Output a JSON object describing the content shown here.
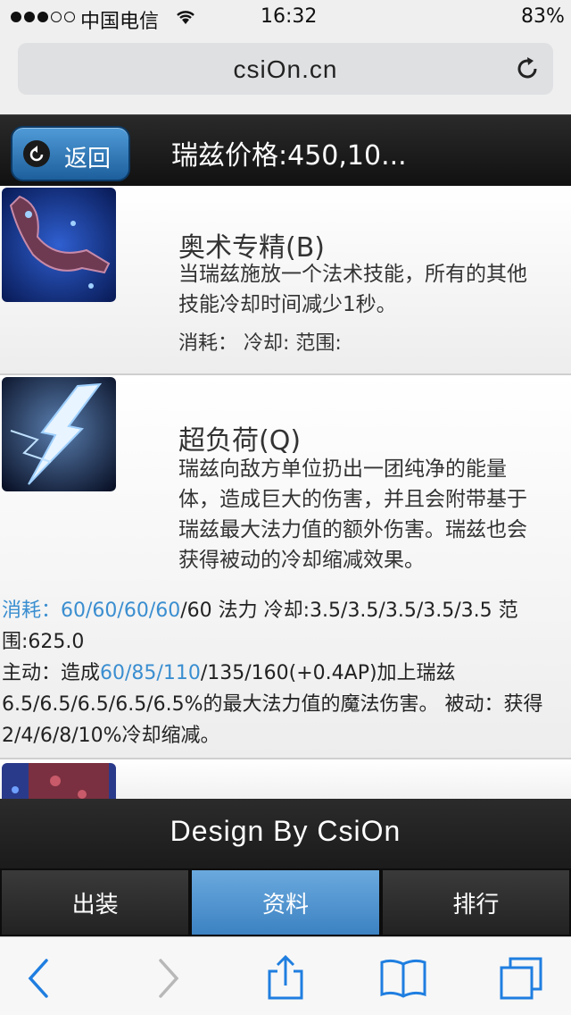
{
  "status_bar": {
    "carrier": "中国电信",
    "time": "16:32",
    "battery": "83%",
    "signal_bars_filled": 3,
    "signal_bars_total": 5
  },
  "browser": {
    "url": "csiOn.cn"
  },
  "header": {
    "back_label": "返回",
    "title": "瑞兹价格:450,10..."
  },
  "skills": [
    {
      "name": "奥术专精(B)",
      "description_lines": [
        "当瑞兹施放一个法术技能，所有的其他",
        "技能冷却时间减少1秒。"
      ],
      "meta": "消耗：  冷却: 范围:"
    },
    {
      "name": "超负荷(Q)",
      "description_lines": [
        "瑞兹向敌方单位扔出一团纯净的能量",
        "体，造成巨大的伤害，并且会附带基于",
        "瑞兹最大法力值的额外伤害。瑞兹也会",
        "获得被动的冷却缩减效果。"
      ],
      "cost_label": "消耗：",
      "cost_highlight": "60/60/60/60",
      "cost_rest": "/60 法力 冷却:3.5/3.5/3.5/3.5/3.5 范",
      "range": "围:625.0",
      "active_prefix": "主动：造成",
      "active_highlight": "60/85/110",
      "active_rest": "/135/160(+0.4AP)加上瑞兹",
      "active_line2": "6.5/6.5/6.5/6.5/6.5%的最大法力值的魔法伤害。 被动：获得",
      "active_line3": "2/4/6/8/10%冷却缩减。"
    }
  ],
  "footer": {
    "brand": "Design By CsiOn"
  },
  "tabs": [
    {
      "label": "出装",
      "active": false
    },
    {
      "label": "资料",
      "active": true
    },
    {
      "label": "排行",
      "active": false
    }
  ],
  "colors": {
    "accent_blue": "#3a8ed0",
    "safari_blue": "#1f7ee0",
    "header_dark": "#1a1a1a"
  },
  "toolbar_icons": [
    "back-arrow-icon",
    "forward-arrow-icon",
    "share-icon",
    "bookmarks-icon",
    "tabs-icon"
  ]
}
